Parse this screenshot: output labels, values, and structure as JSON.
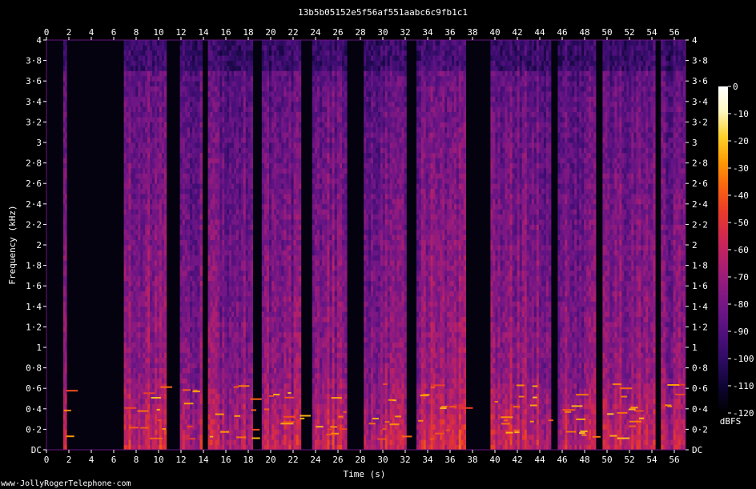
{
  "chart_data": {
    "type": "heatmap",
    "title": "13b5b05152e5f56af551aabc6c9fb1c1",
    "xlabel": "Time (s)",
    "ylabel": "Frequency (kHz)",
    "xlim": [
      0,
      57
    ],
    "ylim": [
      0,
      4
    ],
    "x_ticks": [
      0,
      2,
      4,
      6,
      8,
      10,
      12,
      14,
      16,
      18,
      20,
      22,
      24,
      26,
      28,
      30,
      32,
      34,
      36,
      38,
      40,
      42,
      44,
      46,
      48,
      50,
      52,
      54,
      56
    ],
    "y_ticks": [
      {
        "value": 0,
        "label": "DC"
      },
      {
        "value": 0.2,
        "label": "0·2"
      },
      {
        "value": 0.4,
        "label": "0·4"
      },
      {
        "value": 0.6,
        "label": "0·6"
      },
      {
        "value": 0.8,
        "label": "0·8"
      },
      {
        "value": 1.0,
        "label": "1"
      },
      {
        "value": 1.2,
        "label": "1·2"
      },
      {
        "value": 1.4,
        "label": "1·4"
      },
      {
        "value": 1.6,
        "label": "1·6"
      },
      {
        "value": 1.8,
        "label": "1·8"
      },
      {
        "value": 2.0,
        "label": "2"
      },
      {
        "value": 2.2,
        "label": "2·2"
      },
      {
        "value": 2.4,
        "label": "2·4"
      },
      {
        "value": 2.6,
        "label": "2·6"
      },
      {
        "value": 2.8,
        "label": "2·8"
      },
      {
        "value": 3.0,
        "label": "3"
      },
      {
        "value": 3.2,
        "label": "3·2"
      },
      {
        "value": 3.4,
        "label": "3·4"
      },
      {
        "value": 3.6,
        "label": "3·6"
      },
      {
        "value": 3.8,
        "label": "3·8"
      },
      {
        "value": 4.0,
        "label": "4"
      }
    ],
    "colorbar": {
      "unit": "dBFS",
      "range": [
        -120,
        0
      ],
      "ticks": [
        0,
        -10,
        -20,
        -30,
        -40,
        -50,
        -60,
        -70,
        -80,
        -90,
        -100,
        -110,
        -120
      ],
      "colors": [
        "#000000",
        "#0d0430",
        "#2a0b5e",
        "#4a0f7a",
        "#6a1585",
        "#8c1a80",
        "#b01f6e",
        "#d02850",
        "#ea3a2a",
        "#f86410",
        "#fd9a05",
        "#fbd02a",
        "#fff8c0",
        "#ffffff"
      ]
    },
    "segments": [
      {
        "start": 1.5,
        "end": 1.8,
        "intensity": 0.85
      },
      {
        "start": 6.9,
        "end": 10.7,
        "intensity": 1.0
      },
      {
        "start": 11.9,
        "end": 13.9,
        "intensity": 0.9
      },
      {
        "start": 14.4,
        "end": 18.4,
        "intensity": 0.9
      },
      {
        "start": 19.2,
        "end": 22.7,
        "intensity": 0.95
      },
      {
        "start": 23.7,
        "end": 26.8,
        "intensity": 0.95
      },
      {
        "start": 28.3,
        "end": 32.1,
        "intensity": 0.9
      },
      {
        "start": 33.0,
        "end": 37.4,
        "intensity": 1.0
      },
      {
        "start": 39.6,
        "end": 45.0,
        "intensity": 0.95
      },
      {
        "start": 45.6,
        "end": 49.0,
        "intensity": 0.9
      },
      {
        "start": 49.6,
        "end": 54.3,
        "intensity": 0.95
      },
      {
        "start": 54.8,
        "end": 57.0,
        "intensity": 0.9
      }
    ],
    "grid": false,
    "legend_position": "right"
  },
  "footer": {
    "watermark": "www·JollyRogerTelephone·com"
  }
}
